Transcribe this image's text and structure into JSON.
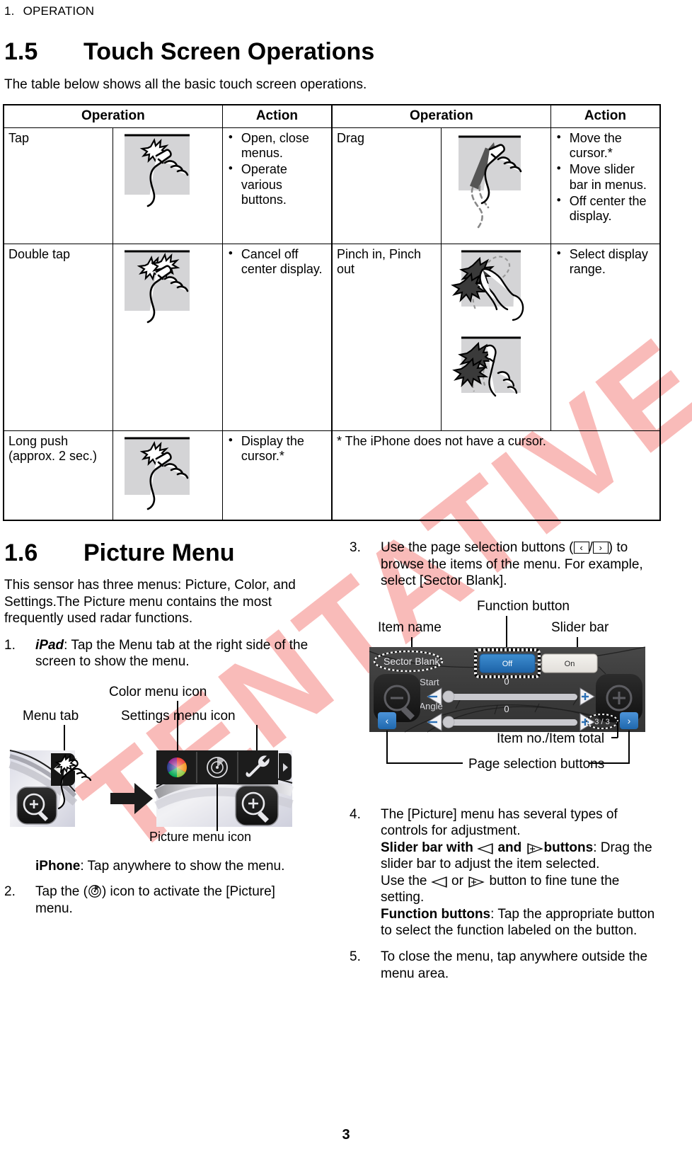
{
  "running_head": {
    "number": "1.",
    "title": "OPERATION"
  },
  "page_number": "3",
  "watermark": "TENTATIVE",
  "section_1_5": {
    "number": "1.5",
    "title": "Touch Screen Operations",
    "intro": "The table below shows all the basic touch screen operations.",
    "table": {
      "headers": [
        "Operation",
        "Action",
        "Operation",
        "Action"
      ],
      "rows": [
        {
          "left_operation": "Tap",
          "left_figure": "tap-gesture-icon",
          "left_actions": [
            "Open, close menus.",
            "Operate various buttons."
          ],
          "right_operation": "Drag",
          "right_figure": "drag-gesture-icon",
          "right_actions": [
            "Move the cursor.*",
            "Move slider bar in menus.",
            "Off center the display."
          ]
        },
        {
          "left_operation": "Double tap",
          "left_figure": "double-tap-gesture-icon",
          "left_actions": [
            "Cancel off center display."
          ],
          "right_operation": "Pinch in, Pinch out",
          "right_figure": "pinch-gesture-icon",
          "right_actions": [
            "Select display range."
          ]
        },
        {
          "left_operation": "Long push (approx. 2 sec.)",
          "left_figure": "long-push-gesture-icon",
          "left_actions": [
            "Display the cursor.*"
          ],
          "right_note": "* The iPhone does not have a cursor."
        }
      ]
    }
  },
  "section_1_6": {
    "number": "1.6",
    "title": "Picture Menu",
    "intro": "This sensor has three menus: Picture, Color, and Settings.The Picture menu contains the most frequently used radar functions.",
    "steps": [
      {
        "n": "1.",
        "lead_bold": "iPad",
        "text": ": Tap the Menu tab at the right side of the screen to show the menu."
      },
      {
        "n": "",
        "lead_bold": "iPhone",
        "text": ": Tap anywhere to show the menu."
      },
      {
        "n": "2.",
        "text_before": "Tap the (",
        "icon": "picture-menu-icon",
        "text_after": ") icon to activate the [Picture] menu."
      },
      {
        "n": "3.",
        "text_before": "Use the page selection buttons (",
        "icon_prev": "chevron-left-icon",
        "sep": "/",
        "icon_next": "chevron-right-icon",
        "text_after": ") to browse the items of the menu. For example, select [Sector Blank]."
      },
      {
        "n": "4.",
        "line1": "The [Picture] menu has several types of controls for adjustment.",
        "slider_bold_a": "Slider bar with",
        "slider_and": "and",
        "slider_bold_b": "buttons",
        "slider_rest": ": Drag the slider bar to adjust the item selected.",
        "fine_before": "Use the",
        "fine_or": "or",
        "fine_after": "button to fine tune the setting.",
        "func_bold": "Function buttons",
        "func_rest": ": Tap the appropriate button to select the function labeled on the button."
      },
      {
        "n": "5.",
        "line1": "To close the menu, tap anywhere outside the menu area."
      }
    ],
    "figure_menutab": {
      "callouts": {
        "menu_tab": "Menu tab",
        "color_menu": "Color menu icon",
        "settings_menu": "Settings menu icon",
        "picture_menu": "Picture menu icon"
      },
      "icons": [
        "color-wheel-icon",
        "radar-picture-icon",
        "wrench-settings-icon",
        "arrow-right-icon",
        "zoom-in-icon"
      ]
    },
    "figure_radarmenu": {
      "callouts": {
        "item_name": "Item name",
        "function_button": "Function button",
        "slider_bar": "Slider bar",
        "item_no_total": "Item no./Item total",
        "page_selection": "Page selection buttons"
      },
      "menu": {
        "item_title": "Sector Blank",
        "buttons": [
          {
            "label": "Off",
            "state": "selected",
            "color": "#2a7ac4"
          },
          {
            "label": "On",
            "state": "normal",
            "color": "#eeece7"
          }
        ],
        "sliders": [
          {
            "label": "Sector Start",
            "value": "0",
            "minus": "−",
            "plus": "+"
          },
          {
            "label": "Sector Angle",
            "value": "0",
            "minus": "−",
            "plus": "+"
          }
        ],
        "page_prev": "‹",
        "page_next": "›",
        "page_indicator": "3 / 3",
        "zoom_out_icon": "zoom-out-icon",
        "zoom_in_icon": "zoom-in-icon"
      }
    }
  }
}
